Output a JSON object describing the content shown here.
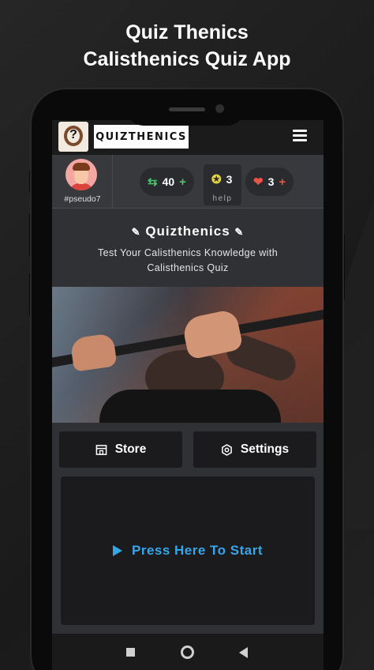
{
  "promo": {
    "line1": "Quiz Thenics",
    "line2": "Calisthenics Quiz App"
  },
  "header": {
    "brand": "QUIZTHENICS",
    "logo_mark": "?"
  },
  "profile": {
    "username": "#pseudo7"
  },
  "stats": {
    "points": {
      "value": "40",
      "plus": "+",
      "color": "#4cc46b"
    },
    "help": {
      "value": "3",
      "label": "help",
      "color": "#e8d23a"
    },
    "lives": {
      "value": "3",
      "plus": "+",
      "color": "#e8534a"
    }
  },
  "intro": {
    "title": "Quizthenics",
    "subtitle": "Test Your Calisthenics Knowledge with Calisthenics Quiz"
  },
  "actions": {
    "store_label": "Store",
    "settings_label": "Settings",
    "start_label": "Press Here To Start"
  },
  "colors": {
    "accent": "#37a6e8",
    "panel": "#1b1b1d",
    "surface": "#303134"
  }
}
